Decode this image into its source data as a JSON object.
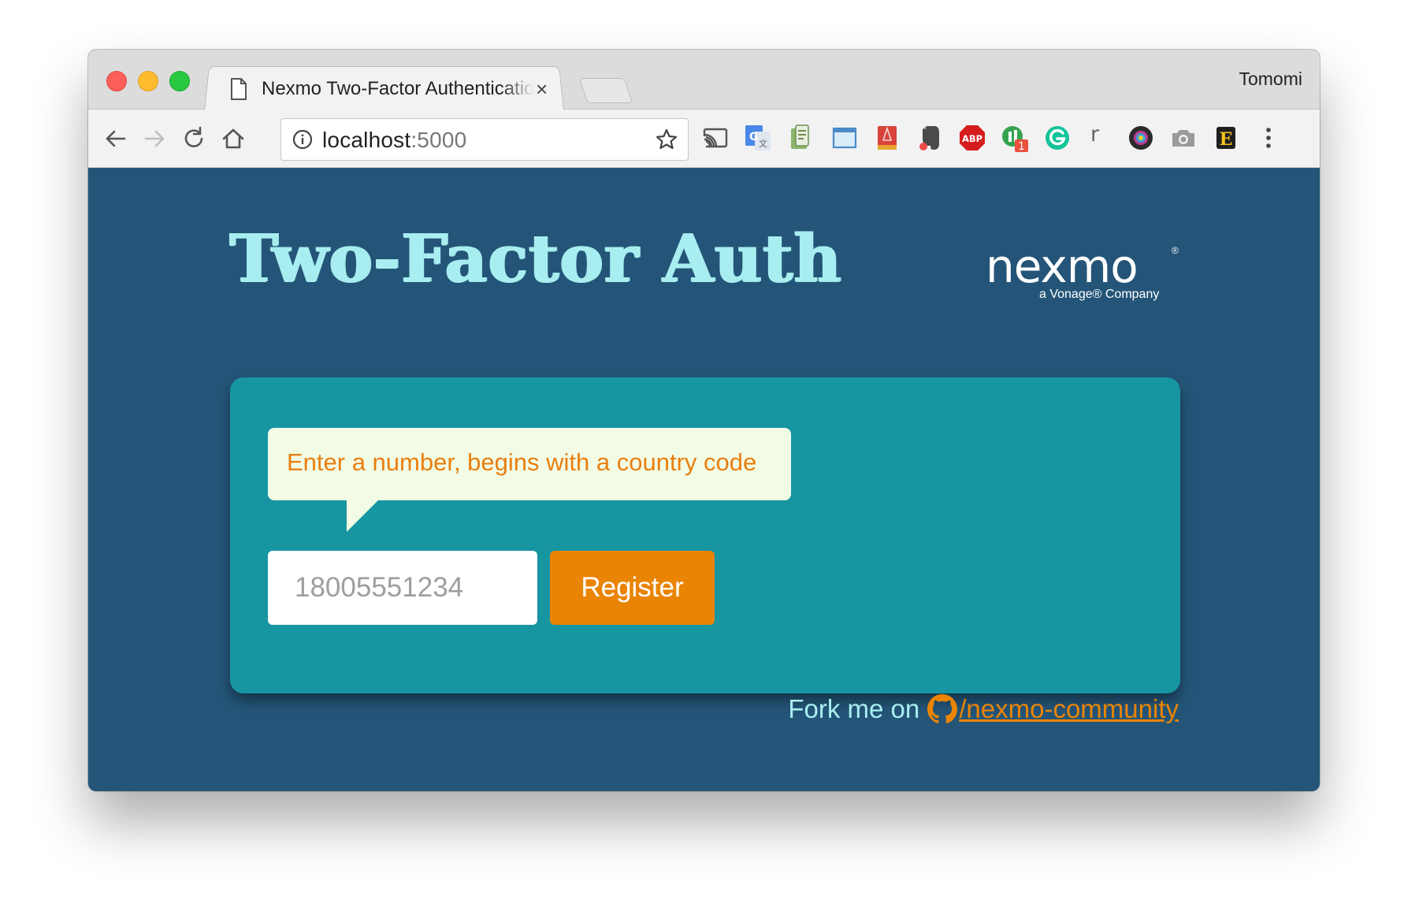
{
  "browser": {
    "tab_title": "Nexmo Two-Factor Authentication",
    "tab_close": "×",
    "profile_name": "Tomomi",
    "url_host": "localhost",
    "url_port": ":5000",
    "extensions": [
      "cast-icon",
      "google-translate-icon",
      "clipboard-icon",
      "screenshot-frame-icon",
      "bookmark-icon",
      "evernote-icon",
      "adblock-icon",
      "badge-extension-icon",
      "grammarly-icon",
      "r-extension-icon",
      "color-picker-icon",
      "camera-icon",
      "e-extension-icon",
      "menu-icon"
    ],
    "adblock_label": "ABP",
    "badge_count": "1",
    "r_label": "r",
    "e_label": "E"
  },
  "page": {
    "title": "Two-Factor Auth",
    "logo": {
      "wordmark": "nexmo",
      "registered": "®",
      "tagline": "a Vonage® Company"
    },
    "tooltip": "Enter a number, begins with a country code",
    "phone_placeholder": "18005551234",
    "register_label": "Register",
    "fork_label": "Fork me on",
    "fork_link_text": "/nexmo-community"
  },
  "colors": {
    "background": "#245578",
    "title": "#a8eef0",
    "card": "#1796a2",
    "accent": "#ea8404",
    "tooltip_bg": "#f2fbe4"
  }
}
